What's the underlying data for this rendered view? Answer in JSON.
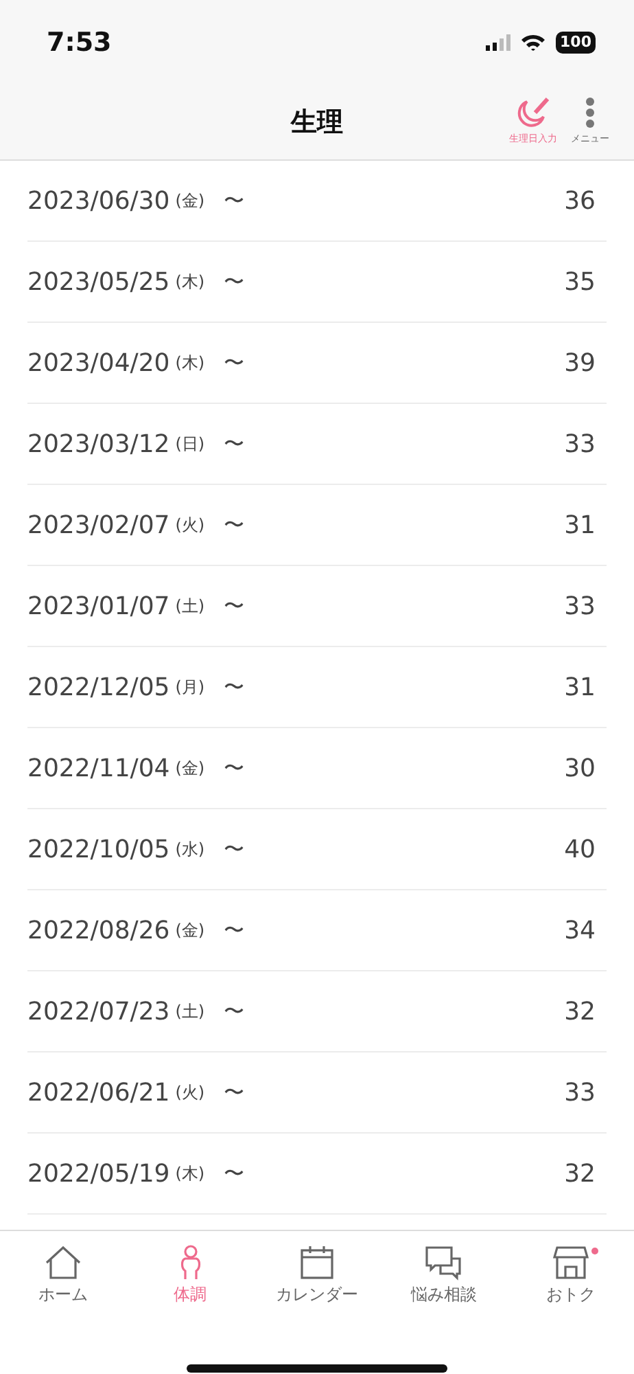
{
  "status_bar": {
    "time": "7:53",
    "battery": "100"
  },
  "header": {
    "title": "生理",
    "actions": [
      {
        "kind": "record",
        "label": "生理日入力"
      },
      {
        "kind": "menu",
        "label": "メニュー"
      }
    ]
  },
  "periods": [
    {
      "date": "2023/06/30",
      "weekday": "(金)",
      "tilde": "〜",
      "days": "36"
    },
    {
      "date": "2023/05/25",
      "weekday": "(木)",
      "tilde": "〜",
      "days": "35"
    },
    {
      "date": "2023/04/20",
      "weekday": "(木)",
      "tilde": "〜",
      "days": "39"
    },
    {
      "date": "2023/03/12",
      "weekday": "(日)",
      "tilde": "〜",
      "days": "33"
    },
    {
      "date": "2023/02/07",
      "weekday": "(火)",
      "tilde": "〜",
      "days": "31"
    },
    {
      "date": "2023/01/07",
      "weekday": "(土)",
      "tilde": "〜",
      "days": "33"
    },
    {
      "date": "2022/12/05",
      "weekday": "(月)",
      "tilde": "〜",
      "days": "31"
    },
    {
      "date": "2022/11/04",
      "weekday": "(金)",
      "tilde": "〜",
      "days": "30"
    },
    {
      "date": "2022/10/05",
      "weekday": "(水)",
      "tilde": "〜",
      "days": "40"
    },
    {
      "date": "2022/08/26",
      "weekday": "(金)",
      "tilde": "〜",
      "days": "34"
    },
    {
      "date": "2022/07/23",
      "weekday": "(土)",
      "tilde": "〜",
      "days": "32"
    },
    {
      "date": "2022/06/21",
      "weekday": "(火)",
      "tilde": "〜",
      "days": "33"
    },
    {
      "date": "2022/05/19",
      "weekday": "(木)",
      "tilde": "〜",
      "days": "32"
    }
  ],
  "tab_bar": [
    {
      "kind": "home",
      "label": "ホーム",
      "selected": false,
      "badge": false
    },
    {
      "kind": "body",
      "label": "体調",
      "selected": true,
      "badge": false
    },
    {
      "kind": "calendar",
      "label": "カレンダー",
      "selected": false,
      "badge": false
    },
    {
      "kind": "chat",
      "label": "悩み相談",
      "selected": false,
      "badge": false
    },
    {
      "kind": "shop",
      "label": "おトク",
      "selected": false,
      "badge": true
    }
  ]
}
